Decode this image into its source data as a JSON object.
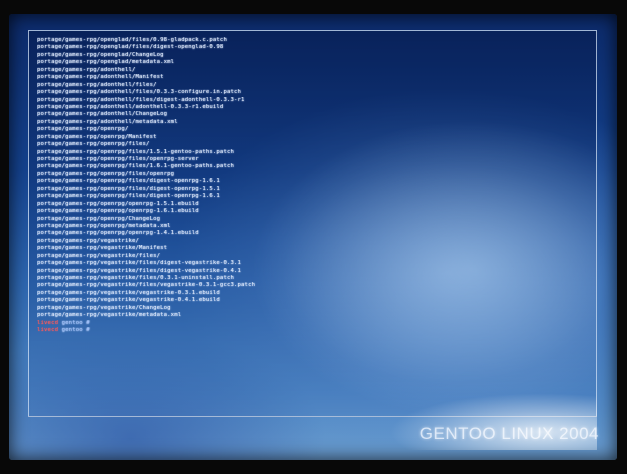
{
  "terminal": {
    "lines": [
      "portage/games-rpg/openglad/files/0.98-gladpack.c.patch",
      "portage/games-rpg/openglad/files/digest-openglad-0.98",
      "portage/games-rpg/openglad/ChangeLog",
      "portage/games-rpg/openglad/metadata.xml",
      "portage/games-rpg/adonthell/",
      "portage/games-rpg/adonthell/Manifest",
      "portage/games-rpg/adonthell/files/",
      "portage/games-rpg/adonthell/files/0.3.3-configure.in.patch",
      "portage/games-rpg/adonthell/files/digest-adonthell-0.3.3-r1",
      "portage/games-rpg/adonthell/adonthell-0.3.3-r1.ebuild",
      "portage/games-rpg/adonthell/ChangeLog",
      "portage/games-rpg/adonthell/metadata.xml",
      "portage/games-rpg/openrpg/",
      "portage/games-rpg/openrpg/Manifest",
      "portage/games-rpg/openrpg/files/",
      "portage/games-rpg/openrpg/files/1.5.1-gentoo-paths.patch",
      "portage/games-rpg/openrpg/files/openrpg-server",
      "portage/games-rpg/openrpg/files/1.6.1-gentoo-paths.patch",
      "portage/games-rpg/openrpg/files/openrpg",
      "portage/games-rpg/openrpg/files/digest-openrpg-1.6.1",
      "portage/games-rpg/openrpg/files/digest-openrpg-1.5.1",
      "portage/games-rpg/openrpg/files/digest-openrpg-1.6.1",
      "portage/games-rpg/openrpg/openrpg-1.5.1.ebuild",
      "portage/games-rpg/openrpg/openrpg-1.6.1.ebuild",
      "portage/games-rpg/openrpg/ChangeLog",
      "portage/games-rpg/openrpg/metadata.xml",
      "portage/games-rpg/openrpg/openrpg-1.4.1.ebuild",
      "portage/games-rpg/vegastrike/",
      "portage/games-rpg/vegastrike/Manifest",
      "portage/games-rpg/vegastrike/files/",
      "portage/games-rpg/vegastrike/files/digest-vegastrike-0.3.1",
      "portage/games-rpg/vegastrike/files/digest-vegastrike-0.4.1",
      "portage/games-rpg/vegastrike/files/0.3.1-uninstall.patch",
      "portage/games-rpg/vegastrike/files/vegastrike-0.3.1-gcc3.patch",
      "portage/games-rpg/vegastrike/vegastrike-0.3.1.ebuild",
      "portage/games-rpg/vegastrike/vegastrike-0.4.1.ebuild",
      "portage/games-rpg/vegastrike/ChangeLog",
      "portage/games-rpg/vegastrike/metadata.xml"
    ],
    "prompts": [
      {
        "host": "livecd",
        "rest": "gentoo #"
      },
      {
        "host": "livecd",
        "rest": "gentoo #"
      }
    ],
    "colors": {
      "text": "#dde8fb",
      "prompt_host": "#ff5a5a",
      "background_top": "#0c2a6a",
      "background_bottom": "#6a9ccf"
    }
  },
  "branding": {
    "text": "GENTOO LINUX 2004"
  }
}
